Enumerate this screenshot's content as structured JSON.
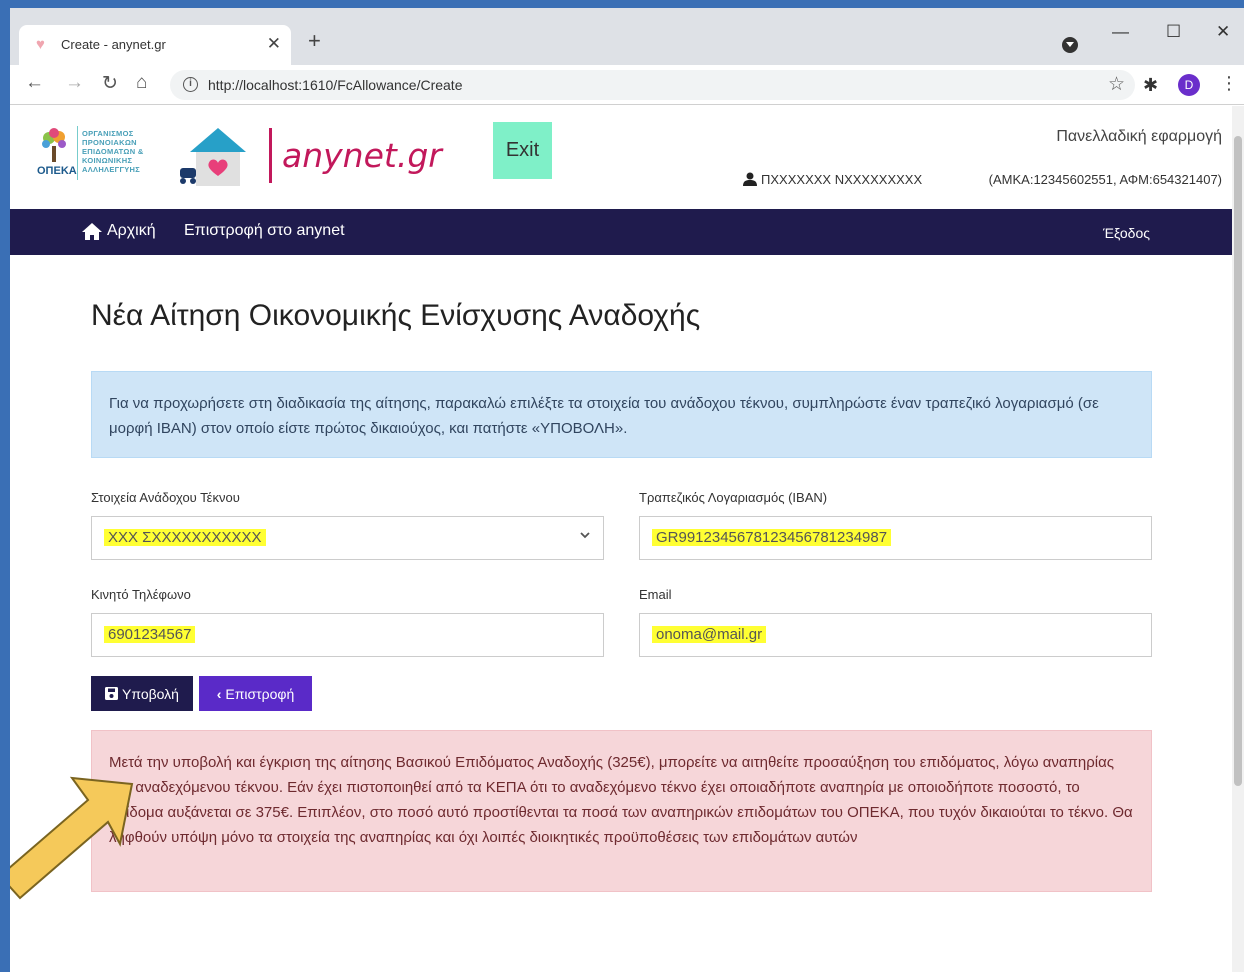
{
  "browser": {
    "tab_title": "Create - anynet.gr",
    "url": "http://localhost:1610/FcAllowance/Create",
    "profile_initial": "D"
  },
  "header": {
    "opeka_lines": [
      "ΟΡΓΑΝΙΣΜΟΣ",
      "ΠΡΟΝΟΙΑΚΩΝ",
      "ΕΠΙΔΟΜΑΤΩΝ &",
      "ΚΟΙΝΩΝΙΚΗΣ",
      "ΑΛΛΗΛΕΓΓΥΗΣ"
    ],
    "opeka_word": "ΟΠΕΚΑ",
    "brand": "anynet.gr",
    "exit_label": "Exit",
    "app_label": "Πανελλαδική εφαρμογή",
    "user_name": "ΠΧΧΧΧΧΧΧ ΝΧΧΧΧΧΧΧΧΧ",
    "user_ids": "(ΑΜΚΑ:12345602551, ΑΦΜ:654321407)"
  },
  "navbar": {
    "home": "Αρχική",
    "back": "Επιστροφή στο anynet",
    "logout": "Έξοδος"
  },
  "main": {
    "title": "Νέα Αίτηση Οικονομικής Ενίσχυσης Αναδοχής",
    "info_text": "Για να προχωρήσετε στη διαδικασία της αίτησης, παρακαλώ επιλέξτε τα στοιχεία του ανάδοχου τέκνου, συμπληρώστε έναν τραπεζικό λογαριασμό (σε μορφή IBAN) στον οποίο είστε πρώτος δικαιούχος, και πατήστε «ΥΠΟΒΟΛΗ».",
    "form": {
      "child_label": "Στοιχεία Ανάδοχου Τέκνου",
      "child_value": "ΧΧΧ ΣΧΧΧΧΧΧΧΧΧΧΧ",
      "iban_label": "Τραπεζικός Λογαριασμός (IBAN)",
      "iban_value": "GR9912345678123456781234987",
      "phone_label": "Κινητό Τηλέφωνο",
      "phone_value": "6901234567",
      "email_label": "Email",
      "email_value": "onoma@mail.gr"
    },
    "submit_label": "Υποβολή",
    "back_label": "Επιστροφή",
    "warning_text": "Μετά την υποβολή και έγκριση της αίτησης Βασικού Επιδόματος Αναδοχής (325€), μπορείτε να αιτηθείτε προσαύξηση του επιδόματος, λόγω αναπηρίας του αναδεχόμενου τέκνου. Εάν έχει πιστοποιηθεί από τα ΚΕΠΑ ότι το αναδεχόμενο τέκνο έχει οποιαδήποτε αναπηρία με οποιοδήποτε ποσοστό, το επίδομα αυξάνεται σε 375€. Επιπλέον, στο ποσό αυτό προστίθενται τα ποσά των αναπηρικών επιδομάτων του ΟΠΕΚΑ, που τυχόν δικαιούται το τέκνο. Θα ληφθούν υπόψη μόνο τα στοιχεία της αναπηρίας και όχι λοιπές διοικητικές προϋποθέσεις των επιδομάτων αυτών"
  },
  "colors": {
    "navbar": "#1f1b4d",
    "brand": "#c2185b",
    "exit": "#7ff0c8",
    "highlight": "#ffff33",
    "back_button": "#5a2ac8",
    "arrow": "#f5c95a"
  }
}
